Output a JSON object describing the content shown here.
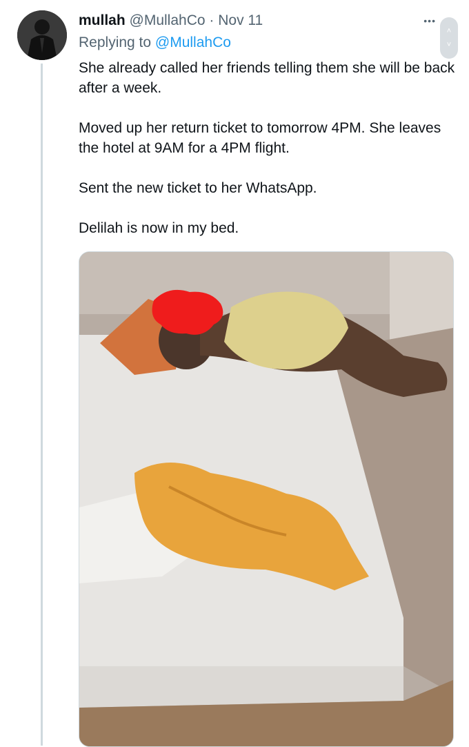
{
  "tweet": {
    "display_name": "mullah",
    "handle": "@MullahCo",
    "separator": "·",
    "date": "Nov 11",
    "replying_prefix": "Replying to",
    "replying_handle": "@MullahCo",
    "paragraphs": [
      "She already called her friends telling them she will be back after a week.",
      "Moved up her return ticket to tomorrow 4PM. She leaves the hotel at 9AM for a 4PM flight.",
      "Sent the new ticket to her WhatsApp.",
      "Delilah is now in my bed."
    ],
    "more_menu_icon": "more-horizontal-icon"
  },
  "scroller": {
    "up_glyph": "˄",
    "down_glyph": "˅"
  },
  "colors": {
    "accent": "#1d9bf0",
    "muted": "#536471",
    "text": "#0f1419",
    "thread": "#cfd9de"
  }
}
